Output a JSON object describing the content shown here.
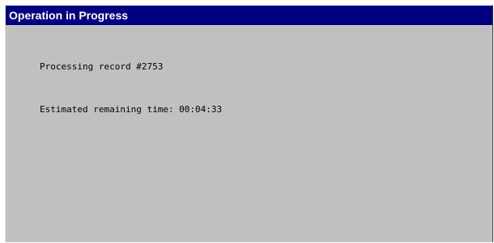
{
  "window": {
    "title": "Operation in Progress"
  },
  "status": {
    "processing_text": "Processing record #2753",
    "remaining_time_text": "Estimated remaining time: 00:04:33"
  },
  "colors": {
    "titlebar": "#000080",
    "title_text": "#ffffff",
    "window_bg": "#c0c0c0"
  }
}
